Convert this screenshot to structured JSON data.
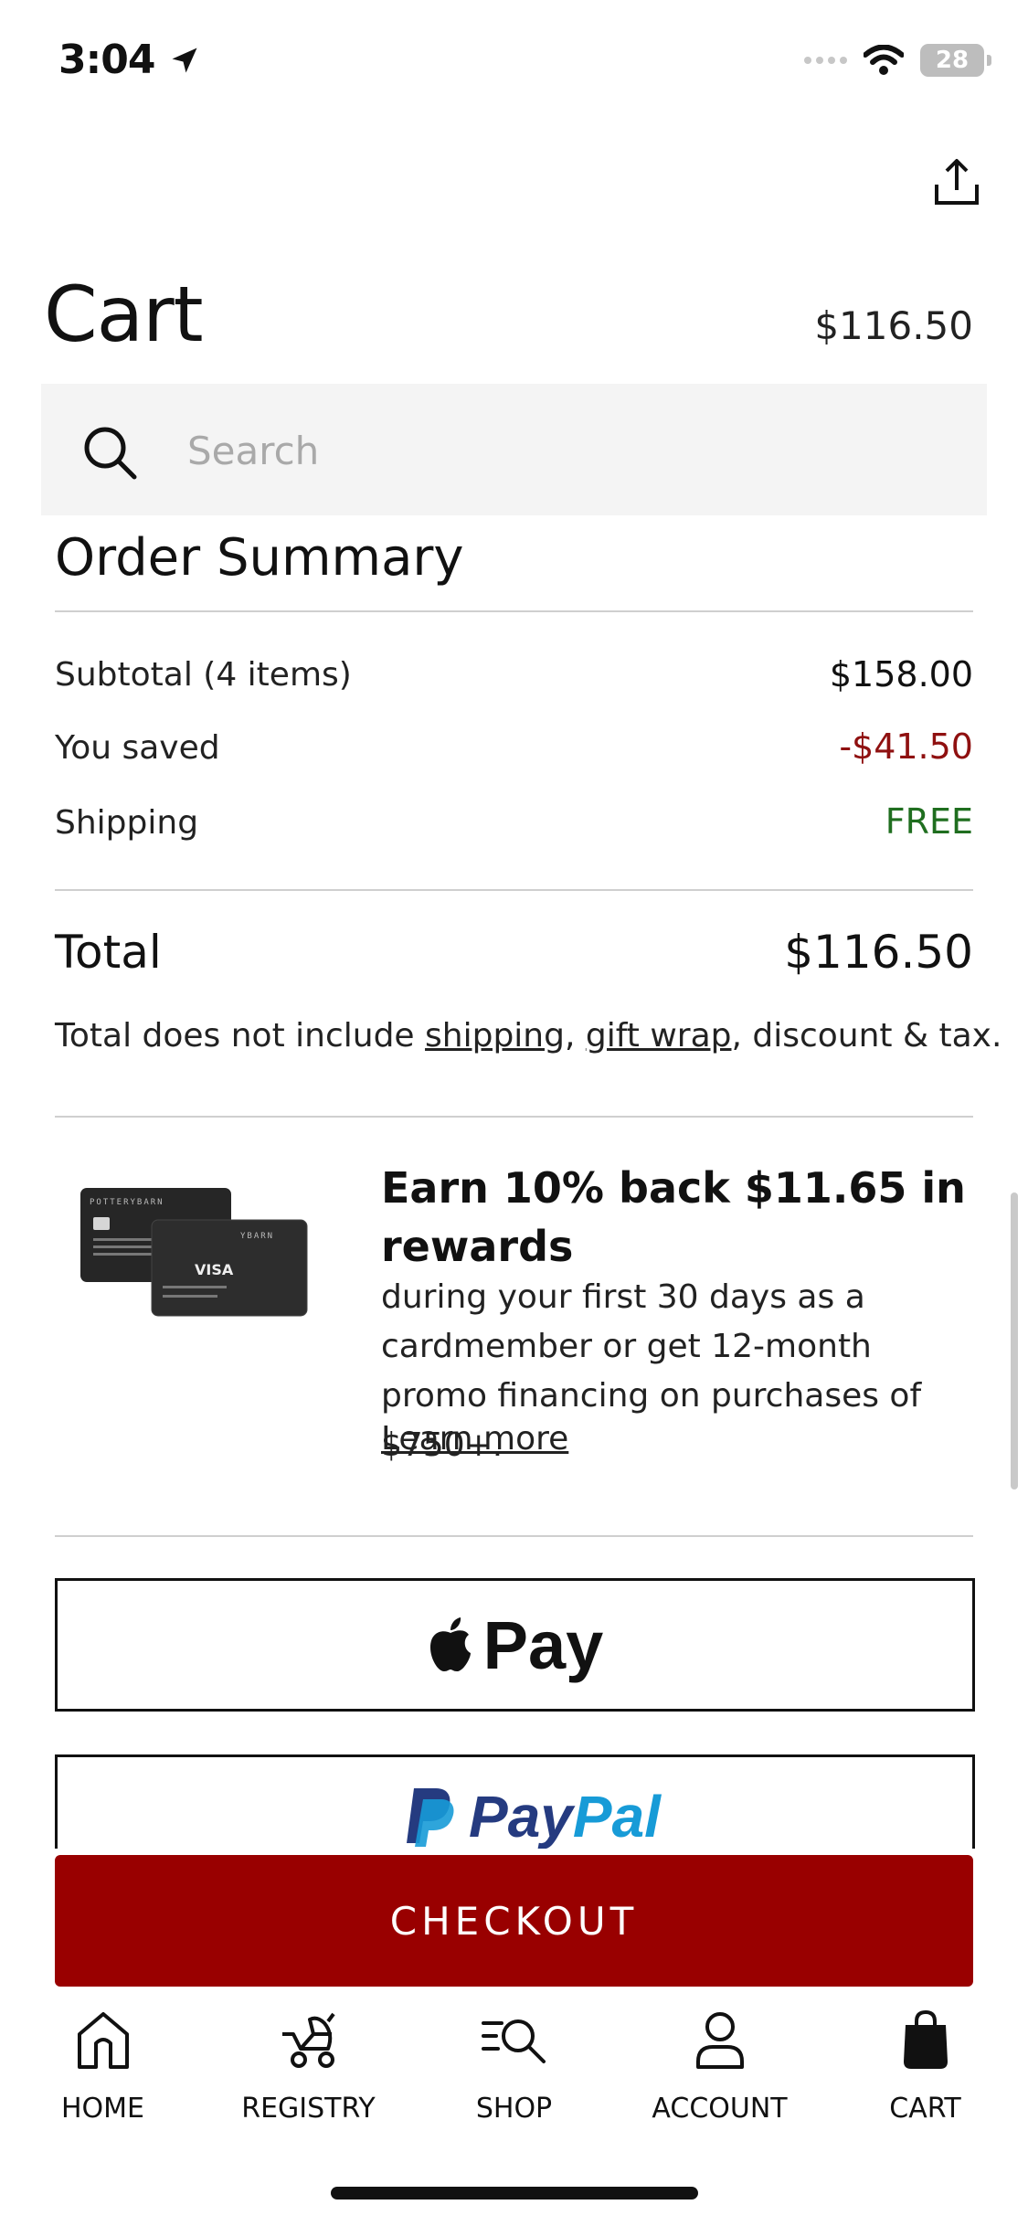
{
  "status": {
    "time": "3:04",
    "battery": "28"
  },
  "header": {
    "title": "Cart",
    "total": "$116.50"
  },
  "search": {
    "placeholder": "Search"
  },
  "summary": {
    "title": "Order Summary",
    "rows": [
      {
        "label": "Subtotal (4 items)",
        "value": "$158.00"
      },
      {
        "label": "You saved",
        "value": "-$41.50"
      },
      {
        "label": "Shipping",
        "value": "FREE"
      }
    ],
    "total_label": "Total",
    "total_value": "$116.50",
    "note_prefix": "Total does not include ",
    "note_link1": "shipping",
    "note_sep": ", ",
    "note_link2": "gift wrap",
    "note_suffix": ", discount & tax."
  },
  "promo": {
    "headline": "Earn 10% back $11.65 in rewards",
    "body": "during your first 30 days as a cardmember or get 12-month promo financing on purchases of $750+.",
    "learn_more": "Learn more",
    "card_brand": "VISA"
  },
  "payments": {
    "apple_pay": "Pay",
    "paypal_1": "Pay",
    "paypal_2": "Pal"
  },
  "checkout": {
    "label": "CHECKOUT"
  },
  "tabs": [
    {
      "label": "HOME",
      "icon": "home-icon"
    },
    {
      "label": "REGISTRY",
      "icon": "stroller-icon"
    },
    {
      "label": "SHOP",
      "icon": "shop-search-icon"
    },
    {
      "label": "ACCOUNT",
      "icon": "person-icon"
    },
    {
      "label": "CART",
      "icon": "bag-icon"
    }
  ],
  "colors": {
    "accent": "#990000",
    "saved": "#8f1010",
    "free": "#1f6e1f"
  }
}
